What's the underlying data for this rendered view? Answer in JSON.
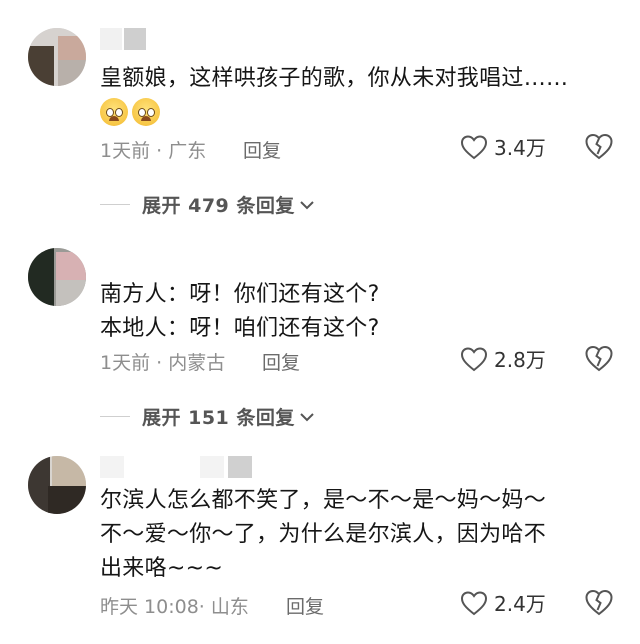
{
  "comments": [
    {
      "text": "皇额娘，这样哄孩子的歌，你从未对我唱过……",
      "emojis": [
        "pleading-face-emoji",
        "pleading-face-emoji"
      ],
      "time": "1天前",
      "location": "广东",
      "reply_label": "回复",
      "likes": "3.4万",
      "expand_label": "展开 479 条回复"
    },
    {
      "text": "南方人：呀！你们还有这个?\n本地人：呀！咱们还有这个?",
      "time": "1天前",
      "location": "内蒙古",
      "reply_label": "回复",
      "likes": "2.8万",
      "expand_label": "展开 151 条回复"
    },
    {
      "text": "尔滨人怎么都不笑了，是～不～是～妈～妈～\n不～爱～你～了，为什么是尔滨人，因为哈不\n出来咯~~~",
      "time": "昨天 10:08",
      "location": "山东",
      "reply_label": "回复",
      "likes": "2.4万"
    }
  ],
  "colors": {
    "meta": "#8e8e8e",
    "text": "#161616",
    "icon": "#555555"
  }
}
